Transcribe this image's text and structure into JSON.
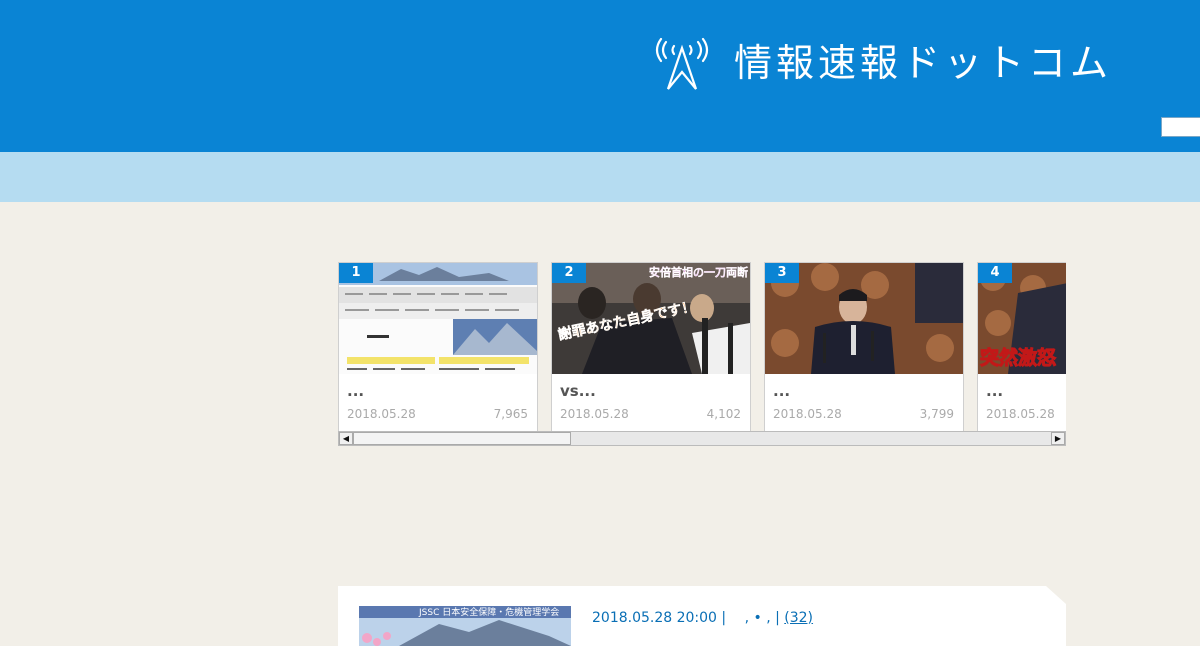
{
  "site": {
    "title": "情報速報ドットコム",
    "logo_icon": "antenna-icon",
    "search_placeholder": ""
  },
  "colors": {
    "brand": "#0a84d4",
    "nav": "#b5dcf1",
    "background": "#f2efe8"
  },
  "ranking": [
    {
      "rank": "1",
      "title": "...",
      "date": "2018.05.28",
      "views": "7,965"
    },
    {
      "rank": "2",
      "title": "vs...",
      "date": "2018.05.28",
      "views": "4,102",
      "overlay_top": "安倍首相の一刀両断",
      "overlay_bottom": "謝罪あなた自身です！"
    },
    {
      "rank": "3",
      "title": "...",
      "date": "2018.05.28",
      "views": "3,799"
    },
    {
      "rank": "4",
      "title": "...",
      "date": "2018.05.28",
      "views": "",
      "overlay": "突然激怒"
    }
  ],
  "post": {
    "datetime": "2018.05.28 20:00",
    "separator": "|",
    "categories": ",  •  ,",
    "comments": "(32)",
    "thumb_text": "JSSC 日本安全保障・危機管理学会"
  }
}
